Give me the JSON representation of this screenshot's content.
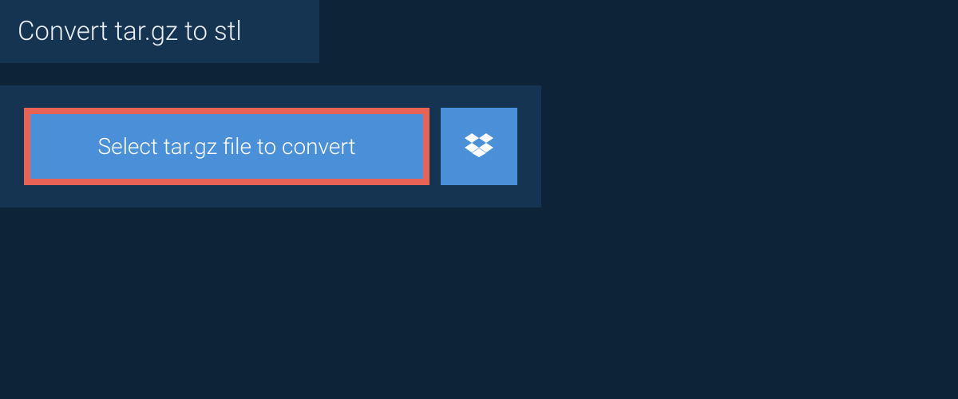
{
  "header": {
    "title": "Convert tar.gz to stl"
  },
  "upload": {
    "select_button_label": "Select tar.gz file to convert",
    "dropbox_icon": "dropbox-icon"
  }
}
